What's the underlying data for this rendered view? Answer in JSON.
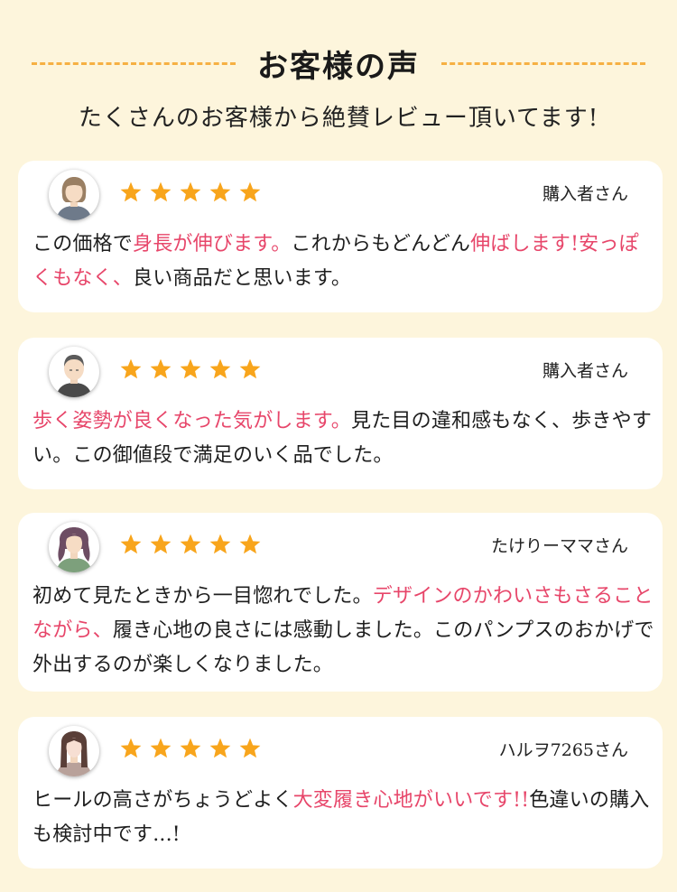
{
  "header": {
    "title": "お客様の声",
    "subtitle": "たくさんのお客様から絶賛レビュー頂いてます!"
  },
  "colors": {
    "background": "#fdf5dc",
    "dash": "#f6b043",
    "star": "#f8a51c",
    "highlight": "#e7466a",
    "card": "#ffffff"
  },
  "reviews": [
    {
      "reviewer": "購入者さん",
      "rating": 5,
      "avatar_icon": "short-hair-woman-icon",
      "segments": [
        {
          "text": "この価格で",
          "highlight": false
        },
        {
          "text": "身長が伸びます。",
          "highlight": true
        },
        {
          "text": "これからもどんどん",
          "highlight": false
        },
        {
          "text": "伸ばします!安っぽくもなく、",
          "highlight": true
        },
        {
          "text": "良い商品だと思います。",
          "highlight": false
        }
      ]
    },
    {
      "reviewer": "購入者さん",
      "rating": 5,
      "avatar_icon": "bald-man-icon",
      "segments": [
        {
          "text": "歩く姿勢が良くなった気がします。",
          "highlight": true
        },
        {
          "text": "見た目の違和感もなく、歩きやすい。この御値段で満足のいく品でした。",
          "highlight": false
        }
      ]
    },
    {
      "reviewer": "たけりーママさん",
      "rating": 5,
      "avatar_icon": "wavy-hair-woman-icon",
      "segments": [
        {
          "text": "初めて見たときから一目惚れでした。",
          "highlight": false
        },
        {
          "text": "デザインのかわいさもさることながら、",
          "highlight": true
        },
        {
          "text": "履き心地の良さには感動しました。このパンプスのおかげで外出するのが楽しくなりました。",
          "highlight": false
        }
      ]
    },
    {
      "reviewer": "ハルヲ7265さん",
      "rating": 5,
      "avatar_icon": "long-hair-woman-icon",
      "segments": [
        {
          "text": "ヒールの高さがちょうどよく",
          "highlight": false
        },
        {
          "text": "大変履き心地がいいです!!",
          "highlight": true
        },
        {
          "text": "色違いの購入も検討中です...!",
          "highlight": false
        }
      ]
    }
  ]
}
